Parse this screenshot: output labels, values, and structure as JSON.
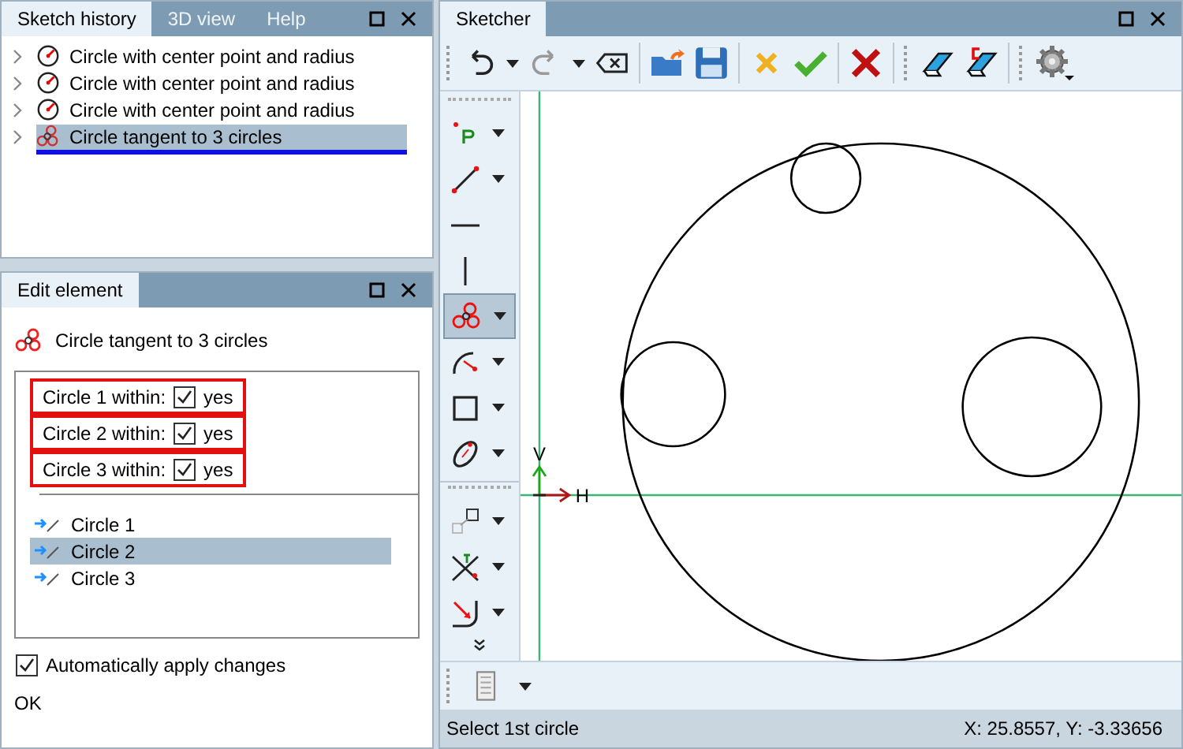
{
  "history_panel": {
    "tabs": [
      {
        "label": "Sketch history",
        "selected": true
      },
      {
        "label": "3D view",
        "selected": false
      },
      {
        "label": "Help",
        "selected": false
      }
    ],
    "items": [
      {
        "kind": "center_radius",
        "label": "Circle with center point and radius",
        "selected": false
      },
      {
        "kind": "center_radius",
        "label": "Circle with center point and radius",
        "selected": false
      },
      {
        "kind": "center_radius",
        "label": "Circle with center point and radius",
        "selected": false
      },
      {
        "kind": "tangent",
        "label": "Circle tangent to 3 circles",
        "selected": true
      }
    ]
  },
  "edit_panel": {
    "tab": "Edit element",
    "title": "Circle tangent to 3 circles",
    "options": [
      {
        "label": "Circle 1 within:",
        "checked": true,
        "value": "yes",
        "highlighted": true
      },
      {
        "label": "Circle 2 within:",
        "checked": true,
        "value": "yes",
        "highlighted": true
      },
      {
        "label": "Circle 3 within:",
        "checked": true,
        "value": "yes",
        "highlighted": true
      }
    ],
    "circles": [
      {
        "label": "Circle 1",
        "selected": false
      },
      {
        "label": "Circle 2",
        "selected": true
      },
      {
        "label": "Circle 3",
        "selected": false
      }
    ],
    "auto_apply": {
      "label": "Automatically apply changes",
      "checked": true
    },
    "ok": "OK"
  },
  "sketcher": {
    "tab": "Sketcher",
    "tools": [
      {
        "kind": "point",
        "dropdown": true,
        "selected": false
      },
      {
        "kind": "line",
        "dropdown": true,
        "selected": false
      },
      {
        "kind": "hline",
        "dropdown": false,
        "selected": false
      },
      {
        "kind": "vline",
        "dropdown": false,
        "selected": false
      },
      {
        "kind": "tangent",
        "dropdown": true,
        "selected": true
      },
      {
        "kind": "arc",
        "dropdown": true,
        "selected": false
      },
      {
        "kind": "rect",
        "dropdown": true,
        "selected": false
      },
      {
        "kind": "ellipse",
        "dropdown": true,
        "selected": false
      },
      {
        "kind": "separator"
      },
      {
        "kind": "transform",
        "dropdown": true,
        "selected": false
      },
      {
        "kind": "trim",
        "dropdown": true,
        "selected": false
      },
      {
        "kind": "fillet",
        "dropdown": true,
        "selected": false
      },
      {
        "kind": "more"
      }
    ],
    "axis_labels": {
      "vertical": "V",
      "horizontal": "H"
    },
    "status": "Select 1st circle",
    "coordinates": "X: 25.8557, Y: -3.33656"
  }
}
